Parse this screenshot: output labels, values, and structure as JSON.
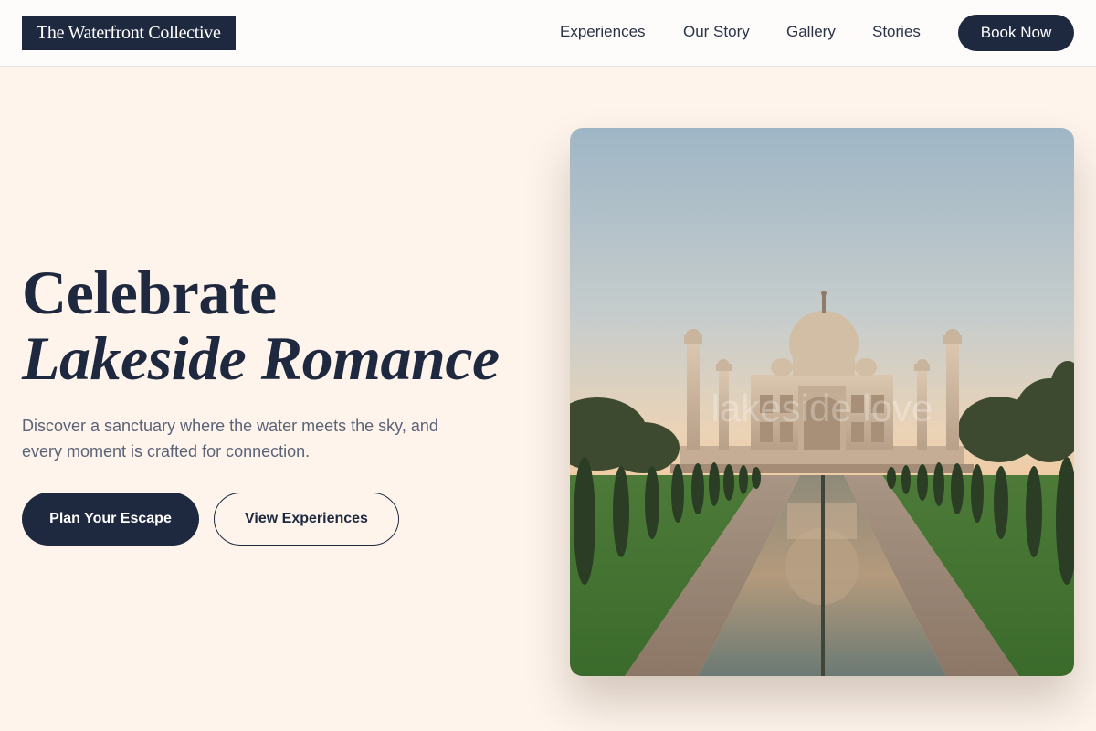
{
  "header": {
    "logo": "The Waterfront Collective",
    "nav": [
      "Experiences",
      "Our Story",
      "Gallery",
      "Stories"
    ],
    "cta_label": "Book Now"
  },
  "hero": {
    "title_line1": "Celebrate",
    "title_line2": "Lakeside Romance",
    "subtitle": "Discover a sanctuary where the water meets the sky, and every moment is crafted for connection.",
    "primary_button": "Plan Your Escape",
    "secondary_button": "View Experiences",
    "image_watermark": "lakeside love"
  },
  "colors": {
    "page_background": "#fef4ec",
    "header_background": "#fdfcfb",
    "brand_navy": "#1e2940",
    "body_text": "#5b6377"
  }
}
